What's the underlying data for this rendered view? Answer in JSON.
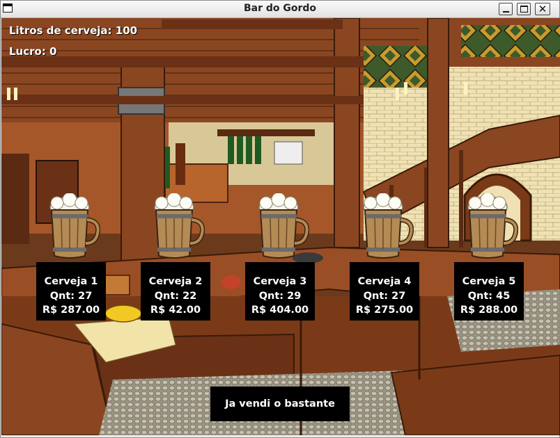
{
  "window": {
    "title": "Bar do Gordo"
  },
  "hud": {
    "litros": "Litros de cerveja: 100",
    "lucro": "Lucro: 0"
  },
  "beers": [
    {
      "name": "Cerveja 1",
      "qnt": "Qnt: 27",
      "price": "R$ 287.00"
    },
    {
      "name": "Cerveja 2",
      "qnt": "Qnt: 22",
      "price": "R$ 42.00"
    },
    {
      "name": "Cerveja 3",
      "qnt": "Qnt: 29",
      "price": "R$ 404.00"
    },
    {
      "name": "Cerveja 4",
      "qnt": "Qnt: 27",
      "price": "R$ 275.00"
    },
    {
      "name": "Cerveja 5",
      "qnt": "Qnt: 45",
      "price": "R$ 288.00"
    }
  ],
  "action": {
    "label": "Ja vendi o bastante"
  },
  "colors": {
    "label_bg": "#000000",
    "label_text": "#ffffff",
    "wood": "#7a3f1d",
    "wall": "#e6d6a8"
  }
}
